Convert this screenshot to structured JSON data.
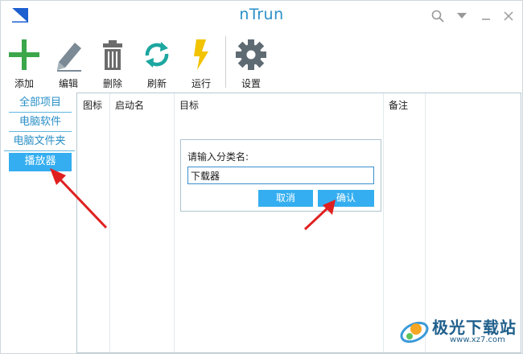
{
  "window": {
    "title": "nTrun"
  },
  "toolbar": {
    "items": [
      {
        "label": "添加",
        "icon": "plus-icon",
        "color": "#3ba64a"
      },
      {
        "label": "编辑",
        "icon": "pencil-icon",
        "color": "#7b8a95"
      },
      {
        "label": "删除",
        "icon": "trash-icon",
        "color": "#6b6b6b"
      },
      {
        "label": "刷新",
        "icon": "refresh-icon",
        "color": "#1ca7a0"
      },
      {
        "label": "运行",
        "icon": "lightning-icon",
        "color": "#f2c300"
      },
      {
        "label": "设置",
        "icon": "gear-icon",
        "color": "#5f6b73"
      }
    ]
  },
  "sidebar": {
    "items": [
      {
        "label": "全部项目",
        "active": false
      },
      {
        "label": "电脑软件",
        "active": false
      },
      {
        "label": "电脑文件夹",
        "active": false
      },
      {
        "label": "播放器",
        "active": true
      }
    ]
  },
  "list": {
    "columns": [
      "图标",
      "启动名",
      "目标",
      "备注"
    ]
  },
  "dialog": {
    "prompt": "请输入分类名:",
    "value": "下载器",
    "cancel_label": "取消",
    "confirm_label": "确认"
  },
  "watermark": {
    "text": "极光下载站",
    "url": "www.xz7.com"
  },
  "colors": {
    "accent": "#34aef0",
    "title": "#2a8fc7",
    "annotation_arrow": "#e02020"
  }
}
